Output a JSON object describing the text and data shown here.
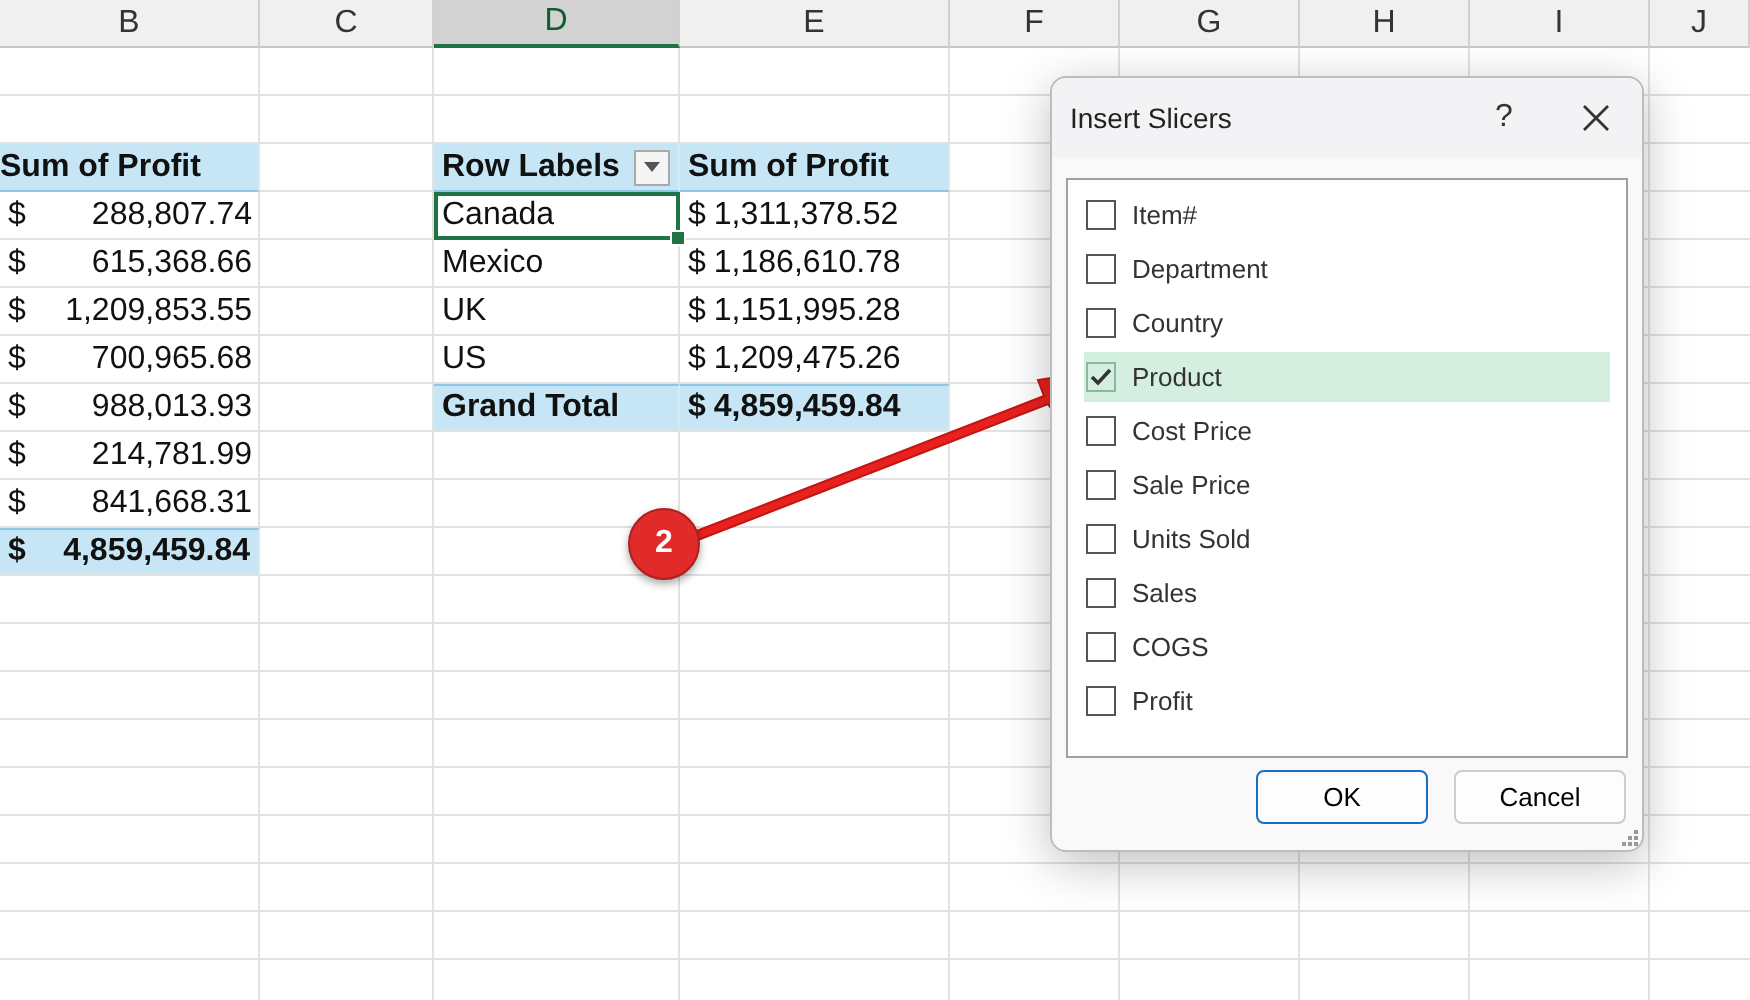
{
  "columns": [
    {
      "label": "B",
      "selected": false
    },
    {
      "label": "C",
      "selected": false
    },
    {
      "label": "D",
      "selected": true
    },
    {
      "label": "E",
      "selected": false
    },
    {
      "label": "F",
      "selected": false
    },
    {
      "label": "G",
      "selected": false
    },
    {
      "label": "H",
      "selected": false
    },
    {
      "label": "I",
      "selected": false
    },
    {
      "label": "J",
      "selected": false
    }
  ],
  "pivot_left": {
    "header": "Sum of Profit",
    "rows": [
      {
        "symbol": "$",
        "amount": "288,807.74"
      },
      {
        "symbol": "$",
        "amount": "615,368.66"
      },
      {
        "symbol": "$",
        "amount": "1,209,853.55"
      },
      {
        "symbol": "$",
        "amount": "700,965.68"
      },
      {
        "symbol": "$",
        "amount": "988,013.93"
      },
      {
        "symbol": "$",
        "amount": "214,781.99"
      },
      {
        "symbol": "$",
        "amount": "841,668.31"
      }
    ],
    "total": {
      "symbol": "$",
      "amount": "4,859,459.84"
    }
  },
  "pivot_right": {
    "row_header": "Row Labels",
    "value_header": "Sum of Profit",
    "rows": [
      {
        "label": "Canada",
        "symbol": "$",
        "amount": "1,311,378.52",
        "selected": true
      },
      {
        "label": "Mexico",
        "symbol": "$",
        "amount": "1,186,610.78",
        "selected": false
      },
      {
        "label": "UK",
        "symbol": "$",
        "amount": "1,151,995.28",
        "selected": false
      },
      {
        "label": "US",
        "symbol": "$",
        "amount": "1,209,475.26",
        "selected": false
      }
    ],
    "total": {
      "label": "Grand Total",
      "symbol": "$",
      "amount": "4,859,459.84"
    }
  },
  "dialog": {
    "title": "Insert Slicers",
    "help": "?",
    "fields": [
      {
        "label": "Item#",
        "checked": false
      },
      {
        "label": "Department",
        "checked": false
      },
      {
        "label": "Country",
        "checked": false
      },
      {
        "label": "Product",
        "checked": true
      },
      {
        "label": "Cost Price",
        "checked": false
      },
      {
        "label": "Sale Price",
        "checked": false
      },
      {
        "label": "Units Sold",
        "checked": false
      },
      {
        "label": "Sales",
        "checked": false
      },
      {
        "label": "COGS",
        "checked": false
      },
      {
        "label": "Profit",
        "checked": false
      }
    ],
    "buttons": [
      {
        "label": "OK",
        "primary": true
      },
      {
        "label": "Cancel",
        "primary": false
      }
    ]
  },
  "annotation": {
    "step": "2"
  }
}
